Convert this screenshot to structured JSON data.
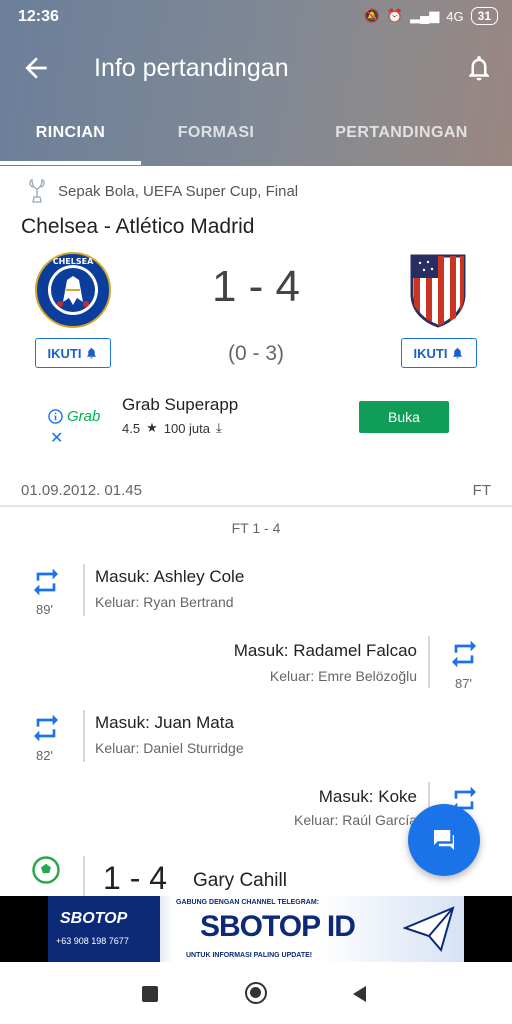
{
  "status_bar": {
    "time": "12:36",
    "network": "4G",
    "battery": "31"
  },
  "toolbar": {
    "title": "Info pertandingan"
  },
  "tabs": [
    {
      "label": "RINCIAN",
      "active": true
    },
    {
      "label": "FORMASI",
      "active": false
    },
    {
      "label": "PERTANDINGAN",
      "active": false
    }
  ],
  "match": {
    "competition": "Sepak Bola, UEFA Super Cup, Final",
    "title": "Chelsea - Atlético Madrid",
    "score": "1 - 4",
    "halftime": "(0 - 3)",
    "home_follow": "IKUTI",
    "away_follow": "IKUTI",
    "date": "01.09.2012. 01.45",
    "status": "FT",
    "home_crest": {
      "color": "#0a3d9c",
      "name": "CHELSEA FOOTBALL CLUB"
    },
    "away_crest": {
      "colors": [
        "#cb3524",
        "#ffffff",
        "#262e62"
      ]
    }
  },
  "ad": {
    "brand": "Grab",
    "title": "Grab Superapp",
    "rating": "4.5",
    "installs": "100 juta",
    "button": "Buka"
  },
  "timeline": {
    "ft_label": "FT 1 - 4",
    "events": [
      {
        "side": "left",
        "minute": "89'",
        "in": "Masuk: Ashley Cole",
        "out": "Keluar: Ryan Bertrand"
      },
      {
        "side": "right",
        "minute": "87'",
        "in": "Masuk: Radamel Falcao",
        "out": "Keluar: Emre Belözoğlu"
      },
      {
        "side": "left",
        "minute": "82'",
        "in": "Masuk: Juan Mata",
        "out": "Keluar: Daniel Sturridge"
      },
      {
        "side": "right",
        "minute": "",
        "in": "Masuk: Koke",
        "out": "Keluar: Raúl García"
      }
    ],
    "goal": {
      "score": "1 - 4",
      "player": "Gary Cahill"
    }
  },
  "banner": {
    "brand": "SBOTOP",
    "phone": "+63 908 198 7677",
    "top_text": "GABUNG DENGAN CHANNEL TELEGRAM:",
    "main_text": "SBOTOP ID",
    "bottom_text": "UNTUK INFORMASI PALING UPDATE!"
  },
  "colors": {
    "accent": "#1a73e8",
    "ad_button": "#0f9d58",
    "banner_navy": "#0c2a78"
  }
}
